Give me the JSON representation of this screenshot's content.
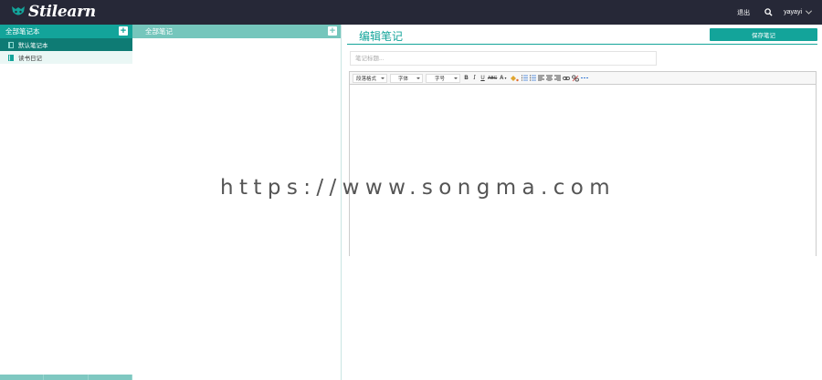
{
  "navbar": {
    "brand": "Stilearn",
    "logout_label": "退出",
    "search_icon": "search-icon",
    "username": "yayayi"
  },
  "sidebar": {
    "header_label": "全部笔记本",
    "notebooks": [
      {
        "label": "默认笔记本",
        "active": true
      },
      {
        "label": "读书日记",
        "active": false
      }
    ]
  },
  "notelist": {
    "header_label": "全部笔记"
  },
  "editor": {
    "heading": "编辑笔记",
    "save_label": "保存笔记",
    "title_placeholder": "笔记标题...",
    "toolbar": {
      "paragraph": "段落格式",
      "font_family": "字体",
      "font_size": "字号",
      "bold": "B",
      "italic": "I",
      "underline": "U",
      "strike": "ABC",
      "font_color": "A"
    }
  },
  "watermark": "https://www.songma.com",
  "colors": {
    "brand": "#13a49a",
    "navbar": "#262837",
    "active_notebook": "#0e7b74"
  }
}
